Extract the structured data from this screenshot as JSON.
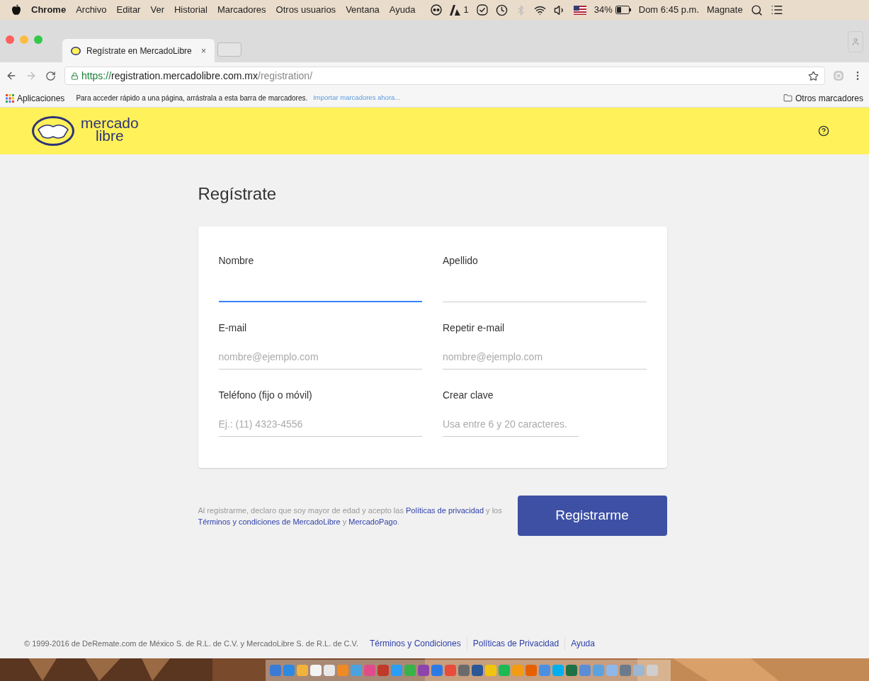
{
  "menu_bar": {
    "items": [
      "Chrome",
      "Archivo",
      "Editar",
      "Ver",
      "Historial",
      "Marcadores",
      "Otros usuarios",
      "Ventana",
      "Ayuda"
    ],
    "adobe_count": "1",
    "battery": "34%",
    "clock": "Dom 6:45 p.m.",
    "user": "Magnate"
  },
  "tabs": [
    {
      "title": "Regístrate en MercadoLibre",
      "close": "×",
      "selected": true
    }
  ],
  "address_bar": {
    "scheme": "https://",
    "host": "registration.mercadolibre.com.mx",
    "path": "/registration/"
  },
  "bookmarks_bar": {
    "apps": "Aplicaciones",
    "hint": "Para acceder rápido a una página, arrástrala a esta barra de marcadores.",
    "import_link": "Importar marcadores ahora...",
    "other": "Otros marcadores"
  },
  "header": {
    "logo_top": "mercado",
    "logo_bottom": "libre"
  },
  "page_title": "Regístrate",
  "form": {
    "fields": [
      {
        "label": "Nombre",
        "focused": true
      },
      {
        "label": "Apellido",
        "focused": false
      },
      {
        "label": "E-mail",
        "placeholder": "nombre@ejemplo.com",
        "focused": false
      },
      {
        "label": "Repetir e-mail",
        "placeholder": "nombre@ejemplo.com",
        "focused": false
      },
      {
        "label": "Teléfono (fijo o móvil)",
        "placeholder": "Ej.: (11) 4323-4556",
        "focused": false
      },
      {
        "label": "Crear clave",
        "placeholder": "Usa entre 6 y 20 caracteres.",
        "focused": false,
        "short": true
      }
    ]
  },
  "terms": [
    {
      "text": "Al registrarme, declaro que soy mayor de edad y acepto las ",
      "kind": "text"
    },
    {
      "text": "Políticas de privacidad",
      "kind": "link"
    },
    {
      "text": " y los ",
      "kind": "text"
    },
    {
      "text": "Términos y condiciones de MercadoLibre",
      "kind": "link"
    },
    {
      "text": " y ",
      "kind": "text"
    },
    {
      "text": "MercadoPago",
      "kind": "link"
    },
    {
      "text": ".",
      "kind": "text"
    }
  ],
  "submit": "Registrarme",
  "footer": {
    "copyright": "© 1999-2016 de DeRemate.com de México S. de R.L. de C.V. y MercadoLibre S. de R.L. de C.V.",
    "links": [
      "Términos y Condiciones",
      "Políticas de Privacidad",
      "Ayuda"
    ]
  }
}
